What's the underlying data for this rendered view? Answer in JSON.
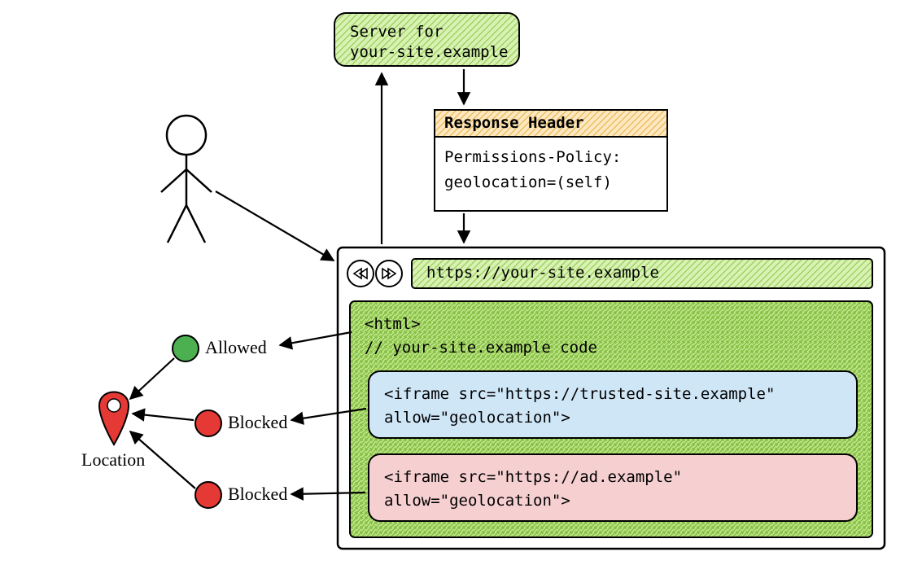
{
  "server": {
    "line1": "Server for",
    "line2": "your-site.example"
  },
  "response_header": {
    "title": "Response Header",
    "line1": "Permissions-Policy:",
    "line2": "   geolocation=(self)"
  },
  "browser": {
    "url": "https://your-site.example",
    "code_line1": "<html>",
    "code_line2": "// your-site.example code",
    "iframe_trusted_line1": "<iframe src=\"https://trusted-site.example\"",
    "iframe_trusted_line2": "   allow=\"geolocation\">",
    "iframe_ad_line1": "<iframe src=\"https://ad.example\"",
    "iframe_ad_line2": "   allow=\"geolocation\">"
  },
  "status": {
    "allowed": "Allowed",
    "blocked1": "Blocked",
    "blocked2": "Blocked"
  },
  "location_label": "Location",
  "colors": {
    "green_fill": "#d9f2b3",
    "green_hatch": "#98cf5b",
    "orange_fill": "#fde8c1",
    "orange_hatch": "#e9b851",
    "blue_fill": "#cfe6f7",
    "pink_fill": "#f6cfd1",
    "red": "#e53935",
    "green_dot": "#4caf50"
  }
}
